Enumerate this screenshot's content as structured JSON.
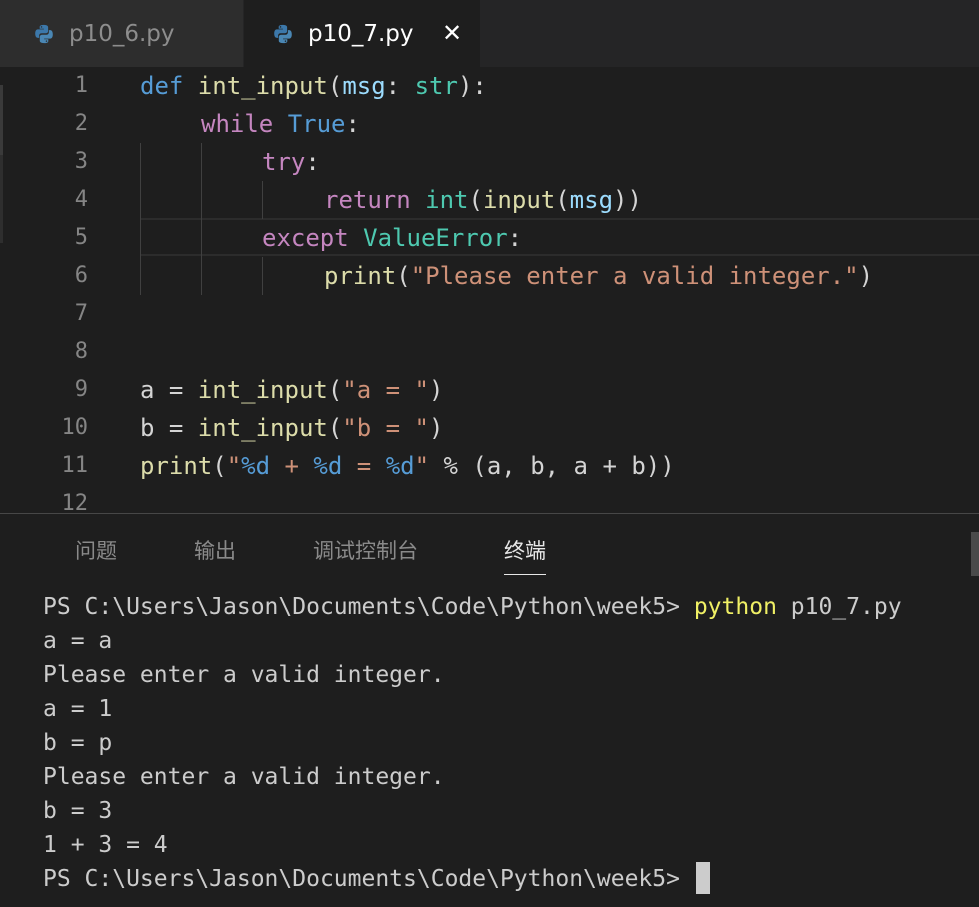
{
  "tabs": [
    {
      "label": "p10_6.py",
      "icon": "python-file-icon",
      "active": false
    },
    {
      "label": "p10_7.py",
      "icon": "python-file-icon",
      "active": true,
      "close_glyph": "✕"
    }
  ],
  "editor": {
    "line_numbers": [
      "1",
      "2",
      "3",
      "4",
      "5",
      "6",
      "7",
      "8",
      "9",
      "10",
      "11",
      "12"
    ],
    "code": {
      "l1": {
        "t1": "def",
        "t2": " int_input",
        "t3": "(",
        "t4": "msg",
        "t5": ": ",
        "t6": "str",
        "t7": "):"
      },
      "l2": {
        "t1": "while",
        "t2": " ",
        "t3": "True",
        "t4": ":"
      },
      "l3": {
        "t1": "try",
        "t2": ":"
      },
      "l4": {
        "t1": "return",
        "t2": " ",
        "t3": "int",
        "t4": "(",
        "t5": "input",
        "t6": "(",
        "t7": "msg",
        "t8": "))"
      },
      "l5": {
        "t1": "except",
        "t2": " ",
        "t3": "ValueError",
        "t4": ":"
      },
      "l6": {
        "t1": "print",
        "t2": "(",
        "t3": "\"Please enter a valid integer.\"",
        "t4": ")"
      },
      "l9": {
        "t1": "a = ",
        "t2": "int_input",
        "t3": "(",
        "t4": "\"a = \"",
        "t5": ")"
      },
      "l10": {
        "t1": "b = ",
        "t2": "int_input",
        "t3": "(",
        "t4": "\"b = \"",
        "t5": ")"
      },
      "l11": {
        "t1": "print",
        "t2": "(",
        "t3": "\"",
        "t4": "%d",
        "t5": " + ",
        "t6": "%d",
        "t7": " = ",
        "t8": "%d",
        "t9": "\"",
        "t10": " % (a, b, a + b))"
      }
    }
  },
  "panel": {
    "tabs": [
      "问题",
      "输出",
      "调试控制台",
      "终端"
    ],
    "active_tab": "终端",
    "terminal": {
      "prompt": "PS C:\\Users\\Jason\\Documents\\Code\\Python\\week5> ",
      "command": "python",
      "command_arg": " p10_7.py",
      "output": [
        "a = a",
        "Please enter a valid integer.",
        "a = 1",
        "b = p",
        "Please enter a valid integer.",
        "b = 3",
        "1 + 3 = 4"
      ],
      "final_prompt": "PS C:\\Users\\Jason\\Documents\\Code\\Python\\week5>"
    }
  },
  "colors": {
    "keyword": "#569cd6",
    "control": "#c586c0",
    "function": "#dcdcaa",
    "parameter": "#9cdcfe",
    "type": "#4ec9b0",
    "string": "#ce9178",
    "command": "#f0f065"
  }
}
